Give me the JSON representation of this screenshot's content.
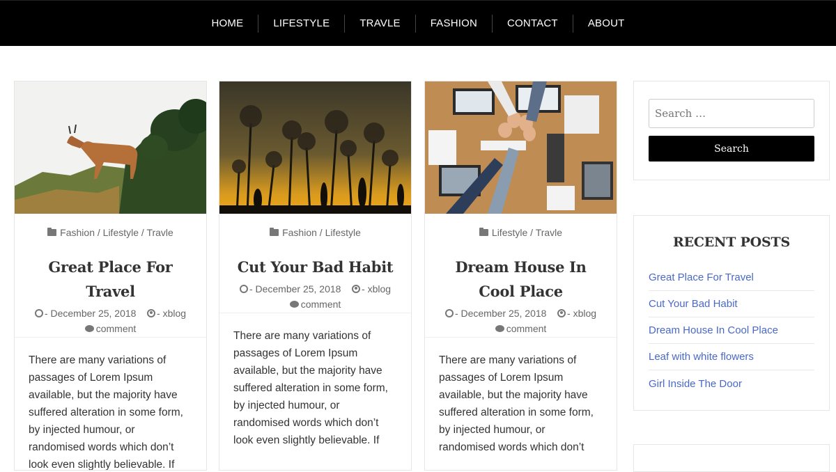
{
  "nav": {
    "items": [
      "HOME",
      "LIFESTYLE",
      "TRAVLE",
      "FASHION",
      "CONTACT",
      "ABOUT"
    ]
  },
  "posts": [
    {
      "image": "mountain-goat-photo",
      "cats": [
        "Fashion",
        "Lifestyle",
        "Travle"
      ],
      "title": "Great Place For Travel",
      "date": "- December 25, 2018",
      "author": "- xblog",
      "comment": "comment",
      "excerpt": "There are many variations of passages of Lorem Ipsum available, but the majority have suffered alteration in some form, by injected humour, or randomised words which don’t look even slightly believable. If"
    },
    {
      "image": "dandelion-sunset-photo",
      "cats": [
        "Fashion",
        "Lifestyle"
      ],
      "title": "Cut Your Bad Habit",
      "date": "- December 25, 2018",
      "author": "- xblog",
      "comment": "comment",
      "excerpt": "There are many variations of passages of Lorem Ipsum available, but the majority have suffered alteration in some form, by injected humour, or randomised words which don’t look even slightly believable. If"
    },
    {
      "image": "team-fist-bump-photo",
      "cats": [
        "Lifestyle",
        "Travle"
      ],
      "title": "Dream House In Cool Place",
      "date": "- December 25, 2018",
      "author": "- xblog",
      "comment": "comment",
      "excerpt": "There are many variations of passages of Lorem Ipsum available, but the majority have suffered alteration in some form, by injected humour, or randomised words which don’t"
    }
  ],
  "search": {
    "placeholder": "Search …",
    "button": "Search"
  },
  "recent": {
    "title": "RECENT POSTS",
    "items": [
      "Great Place For Travel",
      "Cut Your Bad Habit",
      "Dream House In Cool Place",
      "Leaf with white flowers",
      "Girl Inside The Door"
    ]
  },
  "colors": {
    "nav_bg": "#000000",
    "link": "#4a68c9"
  }
}
